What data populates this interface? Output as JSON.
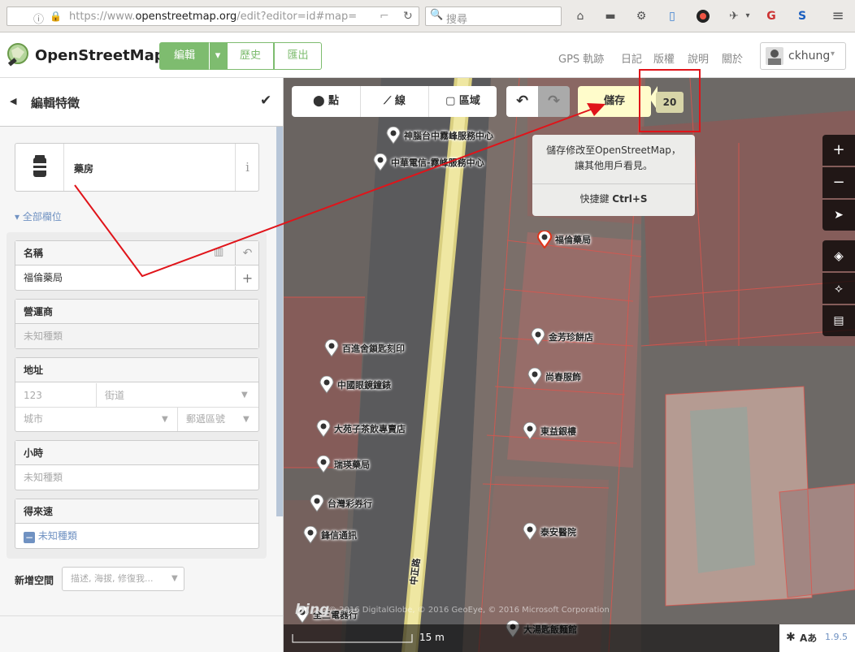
{
  "browser": {
    "url_scheme": "https://www.",
    "url_domain": "openstreetmap.org",
    "url_path": "/edit?editor=id#map=",
    "search_placeholder": "搜尋"
  },
  "osm": {
    "logo_text": "OpenStreetMap",
    "tab_edit": "編輯",
    "tab_history": "歷史",
    "tab_export": "匯出",
    "nav": [
      "GPS 軌跡",
      "日記",
      "版權",
      "說明",
      "關於"
    ],
    "user": "ckhung"
  },
  "sidebar": {
    "header_title": "編輯特徵",
    "preset_name": "藥房",
    "all_fields": "全部欄位",
    "fields": {
      "name_label": "名稱",
      "name_value": "福倫藥局",
      "operator_label": "營運商",
      "operator_placeholder": "未知種類",
      "address_label": "地址",
      "housenumber_placeholder": "123",
      "street_placeholder": "街道",
      "city_placeholder": "城市",
      "postcode_placeholder": "郵遞區號",
      "hours_label": "小時",
      "hours_placeholder": "未知種類",
      "drivethrough_label": "得來速",
      "drivethrough_value": "未知種類"
    },
    "add_field_label": "新增空間",
    "add_field_placeholder": "描述, 海拔, 修復我..."
  },
  "toolbar": {
    "point": "點",
    "line": "線",
    "area": "區域",
    "save": "儲存",
    "edit_count": "20"
  },
  "tooltip": {
    "text": "儲存修改至OpenStreetMap，讓其他用戶看見。",
    "shortcut_prefix": "快捷鍵 ",
    "shortcut_key": "Ctrl+S"
  },
  "map": {
    "pois": [
      "神腦台中霧峰服務中心",
      "中華電信-霧峰服務中心",
      "福倫藥局",
      "金芳珍餅店",
      "尚春服飾",
      "東益銀樓",
      "泰安醫院",
      "百進舍鎖匙刻印",
      "中國眼鏡鐘錶",
      "大苑子茶飲專賣店",
      "瑞瑛藥局",
      "台灣彩券行",
      "鋒信通訊",
      "全三電器行",
      "大湯匙飯麵館"
    ],
    "road_name": "中正路",
    "attribution": "© 2016 DigitalGlobe, © 2016 GeoEye, © 2016 Microsoft Corporation",
    "imagery_brand": "bing",
    "scale_label": "15 m",
    "version": "1.9.5",
    "lang_glyph": "Aあ"
  }
}
